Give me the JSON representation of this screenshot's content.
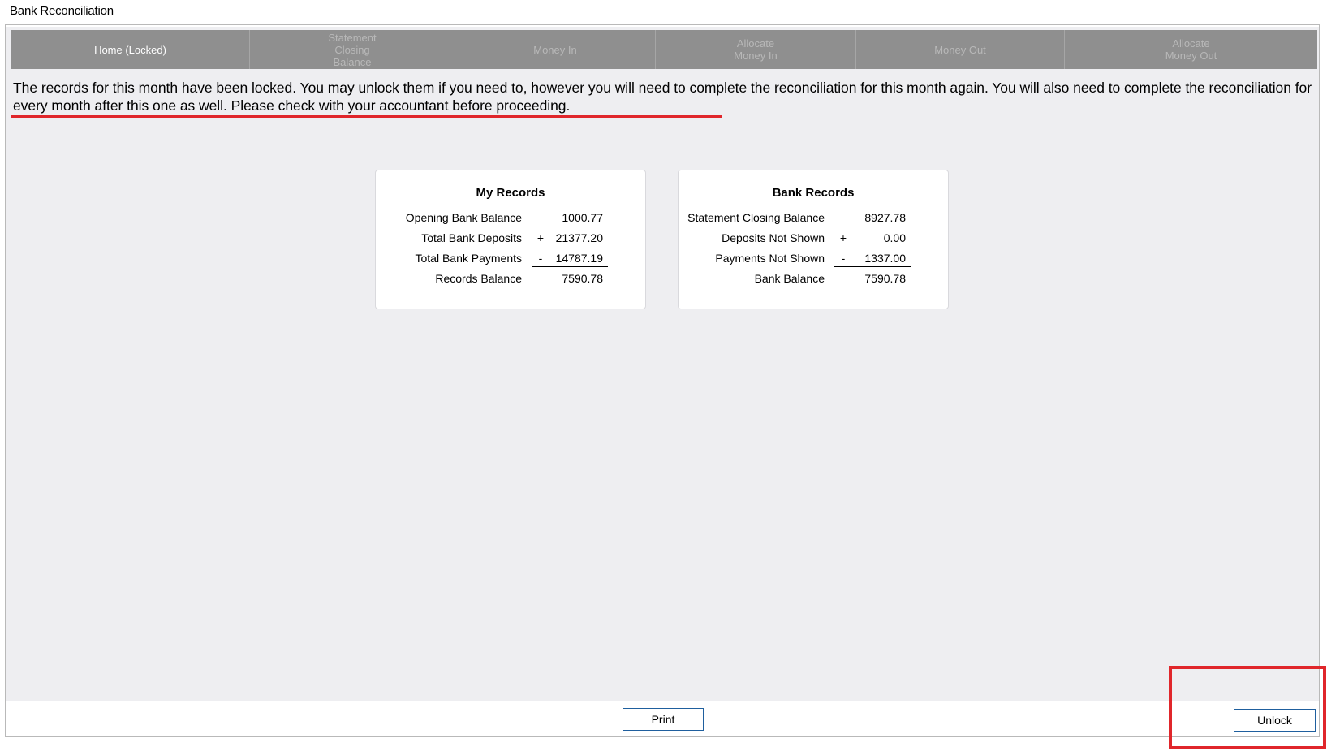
{
  "window": {
    "title": "Bank Reconciliation"
  },
  "tabs": [
    {
      "label": "Home (Locked)",
      "active": true
    },
    {
      "label": "Statement\nClosing\nBalance",
      "active": false
    },
    {
      "label": "Money In",
      "active": false
    },
    {
      "label": "Allocate\nMoney In",
      "active": false
    },
    {
      "label": "Money Out",
      "active": false
    },
    {
      "label": "Allocate\nMoney Out",
      "active": false
    }
  ],
  "notice": "The records for this month have been locked. You may unlock them if you need to, however you will need to complete the reconciliation for this month again. You will also need to complete the reconciliation for every month after this one as well. Please check with your accountant before proceeding.",
  "my_records": {
    "title": "My Records",
    "rows": [
      {
        "label": "Opening Bank Balance",
        "op": "",
        "value": "1000.77"
      },
      {
        "label": "Total Bank Deposits",
        "op": "+",
        "value": "21377.20"
      },
      {
        "label": "Total Bank Payments",
        "op": "-",
        "value": "14787.19"
      },
      {
        "label": "Records Balance",
        "op": "",
        "value": "7590.78"
      }
    ]
  },
  "bank_records": {
    "title": "Bank Records",
    "rows": [
      {
        "label": "Statement Closing Balance",
        "op": "",
        "value": "8927.78"
      },
      {
        "label": "Deposits Not Shown",
        "op": "+",
        "value": "0.00"
      },
      {
        "label": "Payments Not Shown",
        "op": "-",
        "value": "1337.00"
      },
      {
        "label": "Bank Balance",
        "op": "",
        "value": "7590.78"
      }
    ]
  },
  "buttons": {
    "print": "Print",
    "unlock": "Unlock"
  },
  "colors": {
    "annotation_red": "#e0262b",
    "tab_bar": "#8f8f8f",
    "button_border": "#1f5f9e"
  }
}
